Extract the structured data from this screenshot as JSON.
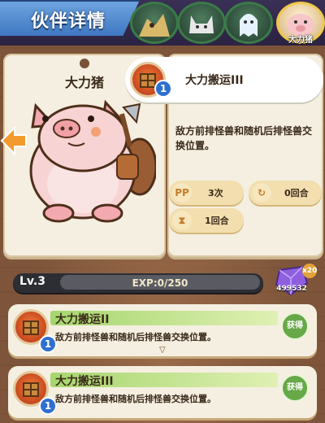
{
  "header": {
    "title": "伙伴详情",
    "selected_partner_name": "大力猪"
  },
  "pet": {
    "name": "大力猪"
  },
  "current_skill": {
    "name": "大力搬运III",
    "level": "1",
    "description": "敌方前排怪兽和随机后排怪兽交换位置。",
    "stats": [
      {
        "icon": "PP",
        "value": "3次"
      },
      {
        "icon": "cooldown-icon",
        "value": "0回合"
      },
      {
        "icon": "hourglass-icon",
        "value": "1回合"
      }
    ]
  },
  "level_bar": {
    "level": "Lv.3",
    "exp": "EXP:0/250",
    "progress": 0.0
  },
  "gem": {
    "badge": "x20",
    "count": "499532"
  },
  "skill_list": [
    {
      "name": "大力搬运II",
      "level": "1",
      "description": "敌方前排怪兽和随机后排怪兽交换位置。",
      "status": "获得"
    },
    {
      "name": "大力搬运III",
      "level": "1",
      "description": "敌方前排怪兽和随机后排怪兽交换位置。",
      "status": "获得"
    }
  ],
  "colors": {
    "accent_blue": "#3f78c2",
    "get_green": "#67a848",
    "skill_orange": "#f47b36"
  }
}
